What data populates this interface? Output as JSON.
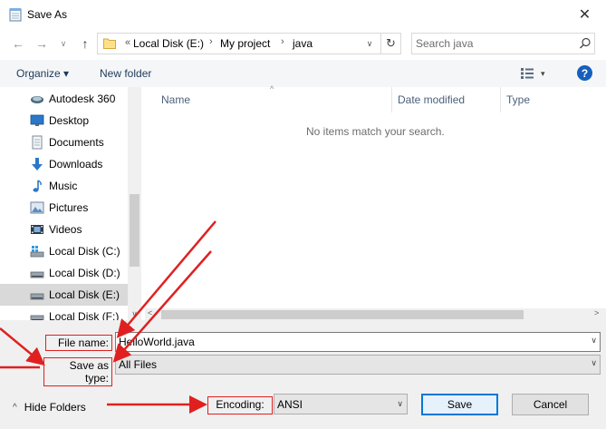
{
  "window": {
    "title": "Save As",
    "close_glyph": "✕"
  },
  "nav": {
    "back_glyph": "←",
    "forward_glyph": "→",
    "recent_glyph": "∨",
    "up_glyph": "↑",
    "crumb_overflow": "«",
    "breadcrumb": [
      "Local Disk (E:)",
      "My project",
      "java"
    ],
    "crumb_sep": "›",
    "dropdown_glyph": "∨",
    "refresh_glyph": "↻"
  },
  "search": {
    "placeholder": "Search java"
  },
  "toolbar": {
    "organize_label": "Organize ▾",
    "new_folder_label": "New folder",
    "view_dd": "▾",
    "help_label": "?"
  },
  "sidebar": {
    "items": [
      {
        "label": "Autodesk 360",
        "icon": "autodesk-cloud-icon",
        "selected": false
      },
      {
        "label": "Desktop",
        "icon": "desktop-icon",
        "selected": false
      },
      {
        "label": "Documents",
        "icon": "documents-icon",
        "selected": false
      },
      {
        "label": "Downloads",
        "icon": "downloads-icon",
        "selected": false
      },
      {
        "label": "Music",
        "icon": "music-icon",
        "selected": false
      },
      {
        "label": "Pictures",
        "icon": "pictures-icon",
        "selected": false
      },
      {
        "label": "Videos",
        "icon": "videos-icon",
        "selected": false
      },
      {
        "label": "Local Disk (C:)",
        "icon": "windows-drive-icon",
        "selected": false
      },
      {
        "label": "Local Disk (D:)",
        "icon": "drive-icon",
        "selected": false
      },
      {
        "label": "Local Disk (E:)",
        "icon": "drive-icon",
        "selected": true
      },
      {
        "label": "Local Disk (F:)",
        "icon": "drive-icon",
        "selected": false
      }
    ],
    "scroll_down_glyph": "∨"
  },
  "content": {
    "columns": [
      "Name",
      "Date modified",
      "Type"
    ],
    "sort_glyph": "^",
    "empty_message": "No items match your search.",
    "scroll_left_glyph": "<",
    "scroll_right_glyph": ">"
  },
  "form": {
    "file_name_label": "File name:",
    "file_name_value": "HelloWorld.java",
    "save_type_label": "Save as type:",
    "save_type_value": "All Files",
    "encoding_label": "Encoding:",
    "encoding_value": "ANSI",
    "dd_glyph": "∨"
  },
  "footer": {
    "hide_folders_glyph": "^",
    "hide_folders_label": "Hide Folders",
    "save_label": "Save",
    "cancel_label": "Cancel"
  },
  "colors": {
    "accent": "#0078d7",
    "annotation_red": "#e02020",
    "toolbar_text": "#1e395b",
    "help_blue": "#1560bd"
  }
}
